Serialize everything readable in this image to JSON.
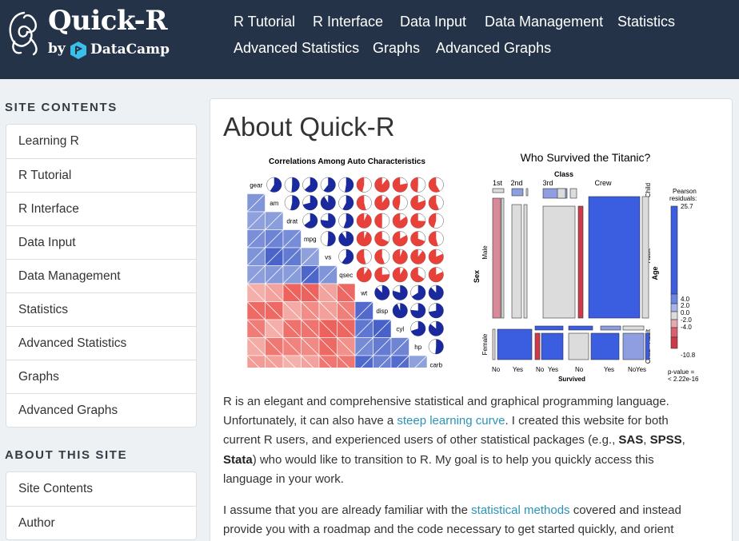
{
  "brand": {
    "title": "Quick-R",
    "by": "by",
    "partner": "DataCamp"
  },
  "nav": [
    "R Tutorial",
    "R Interface",
    "Data Input",
    "Data Management",
    "Statistics",
    "Advanced Statistics",
    "Graphs",
    "Advanced Graphs"
  ],
  "sidebar": {
    "site_contents_heading": "SITE CONTENTS",
    "site_contents": [
      "Learning R",
      "R Tutorial",
      "R Interface",
      "Data Input",
      "Data Management",
      "Statistics",
      "Advanced Statistics",
      "Graphs",
      "Advanced Graphs"
    ],
    "about_heading": "ABOUT THIS SITE",
    "about": [
      "Site Contents",
      "Author"
    ]
  },
  "page": {
    "title": "About Quick-R",
    "p1": {
      "t1": "R is an elegant and comprehensive statistical and graphical programming language. Unfortunately, it can also have a ",
      "link": "steep learning curve",
      "t2": ". I created this website for both current R users, and experienced users of other statistical packages (e.g., ",
      "sas": "SAS",
      "sep1": ", ",
      "spss": "SPSS",
      "sep2": ", ",
      "stata": "Stata",
      "t3": ") who would like to transition to R. My goal is to help you quickly access this language in your work."
    },
    "p2": {
      "t1": "I assume that you are already familiar with the ",
      "link": "statistical methods",
      "t2": " covered and instead provide you with a roadmap and the code necessary to get started quickly, and orient"
    }
  },
  "corrgram": {
    "title": "Correlations Among Auto Characteristics",
    "variables": [
      "gear",
      "am",
      "drat",
      "mpg",
      "vs",
      "qsec",
      "wt",
      "disp",
      "cyl",
      "hp",
      "carb"
    ]
  },
  "mosaic": {
    "title": "Who Survived the Titanic?",
    "class_label": "Class",
    "classes": [
      "1st",
      "2nd",
      "3rd",
      "Crew"
    ],
    "sex_label": "Sex",
    "sexes": [
      "Male",
      "Female"
    ],
    "age_label": "Age",
    "ages": [
      "Child",
      "Adult",
      "Adult",
      "Child"
    ],
    "survived_label": "Survived",
    "survived_ticks": [
      "No",
      "Yes",
      "No",
      "Yes",
      "No",
      "Yes",
      "No",
      "Yes"
    ],
    "legend_title": [
      "Pearson",
      "residuals:"
    ],
    "legend_ticks": [
      "25.7",
      "4.0",
      "2.0",
      "0.0",
      "-2.0",
      "-4.0",
      "-10.8"
    ],
    "p_value": [
      "p-value =",
      "< 2.22e-16"
    ]
  },
  "colors": {
    "header_bg": "#243348",
    "link": "#2a93b8",
    "positive": "#1f3fb8",
    "negative": "#e8413a"
  }
}
